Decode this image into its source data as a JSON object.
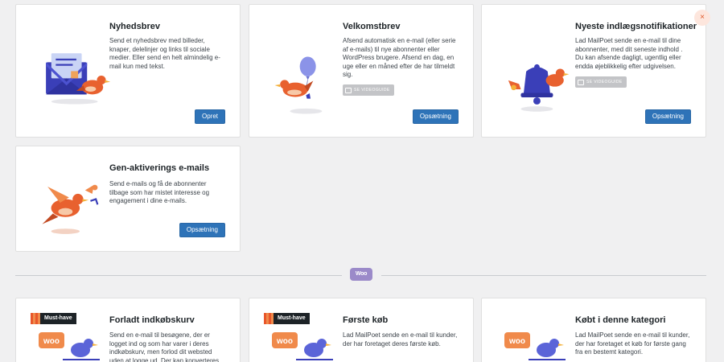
{
  "cards": [
    {
      "title": "Nyhedsbrev",
      "desc": "Send et nyhedsbrev med billeder, knaper, delelinjer og links til sociale medier. Eller send en helt almindelig e-mail kun med tekst.",
      "button": "Opret",
      "icon": "envelope-bird-icon"
    },
    {
      "title": "Velkomstbrev",
      "desc": "Afsend automatisk en e-mail (eller serie af e-mails) til nye abonnenter eller WordPress brugere. Afsend en dag, en uge eller en måned efter de har tilmeldt sig.",
      "video": "Se videoguide",
      "button": "Opsætning",
      "icon": "bird-balloon-icon"
    },
    {
      "title": "Nyeste indlægsnotifikationer",
      "desc": "Lad MailPoet sende en e-mail til dine abonnenter, med dit seneste indhold . Du kan afsende dagligt, ugentlig eller endda øjeblikkelig efter udgivelsen.",
      "video": "Se videoguide",
      "button": "Opsætning",
      "icon": "bird-bell-icon"
    },
    {
      "title": "Gen-aktiverings e-mails",
      "desc": "Send e-mails og få de abonnenter tilbage som har mistet interesse og engagement i dine e-mails.",
      "button": "Opsætning",
      "icon": "birds-flying-icon"
    }
  ],
  "woo_label": "Woo",
  "woo_cards": [
    {
      "badge": "Must-have",
      "title": "Forladt indkøbskurv",
      "desc": "Send en e-mail til besøgene, der er logget ind og som har varer i deres indkøbskurv, men forlod dit websted uden at logge ud. Der kan konverteres"
    },
    {
      "badge": "Must-have",
      "title": "Første køb",
      "desc": "Lad MailPoet sende en e-mail til kunder, der har foretaget deres første køb."
    },
    {
      "title": "Købt i denne kategori",
      "desc": "Lad MailPoet sende en e-mail til kunder, der har foretaget et køb for første gang fra en bestemt kategori."
    }
  ],
  "close_symbol": "×"
}
